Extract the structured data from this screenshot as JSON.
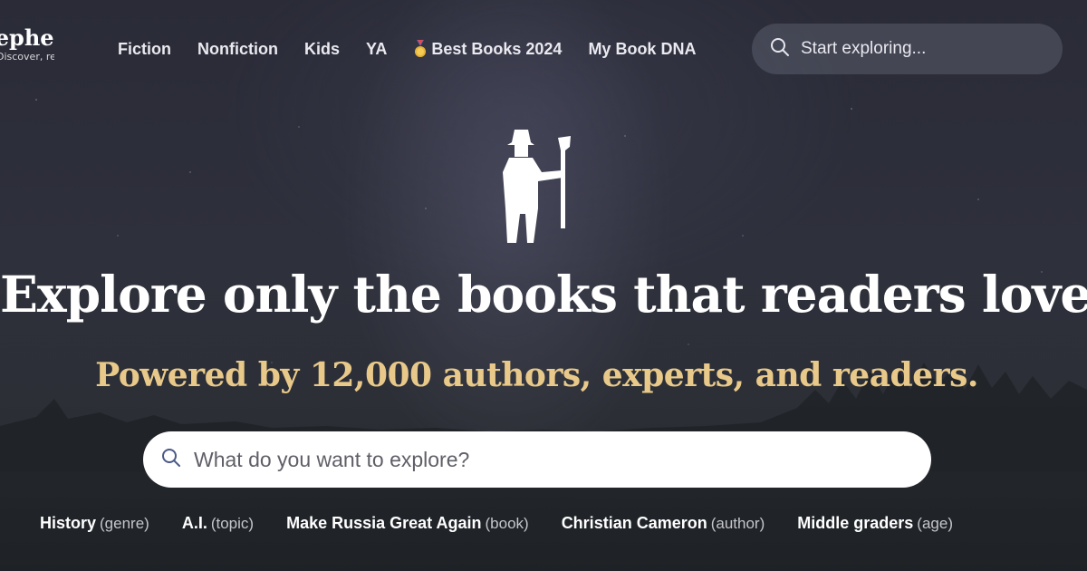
{
  "brand": {
    "name": "Shepherd",
    "tagline": "Discover, read."
  },
  "nav": {
    "items": [
      {
        "label": "Fiction"
      },
      {
        "label": "Nonfiction"
      },
      {
        "label": "Kids"
      },
      {
        "label": "YA"
      },
      {
        "label": "Best Books 2024",
        "icon": "medal-icon"
      },
      {
        "label": "My Book DNA"
      }
    ]
  },
  "top_search": {
    "placeholder": "Start exploring...",
    "icon": "search-icon"
  },
  "hero": {
    "icon": "shepherd-figure-icon",
    "headline": "Explore only the books that readers loved.",
    "subheadline": "Powered by 12,000 authors, experts, and readers.",
    "search_placeholder": "What do you want to explore?"
  },
  "suggestions": [
    {
      "term": "History",
      "kind": "(genre)"
    },
    {
      "term": "A.I.",
      "kind": "(topic)"
    },
    {
      "term": "Make Russia Great Again",
      "kind": "(book)"
    },
    {
      "term": "Christian Cameron",
      "kind": "(author)"
    },
    {
      "term": "Middle graders",
      "kind": "(age)"
    }
  ],
  "colors": {
    "accent": "#e8c98a",
    "background": "#2c2e3a",
    "search_bg": "#ffffff"
  }
}
